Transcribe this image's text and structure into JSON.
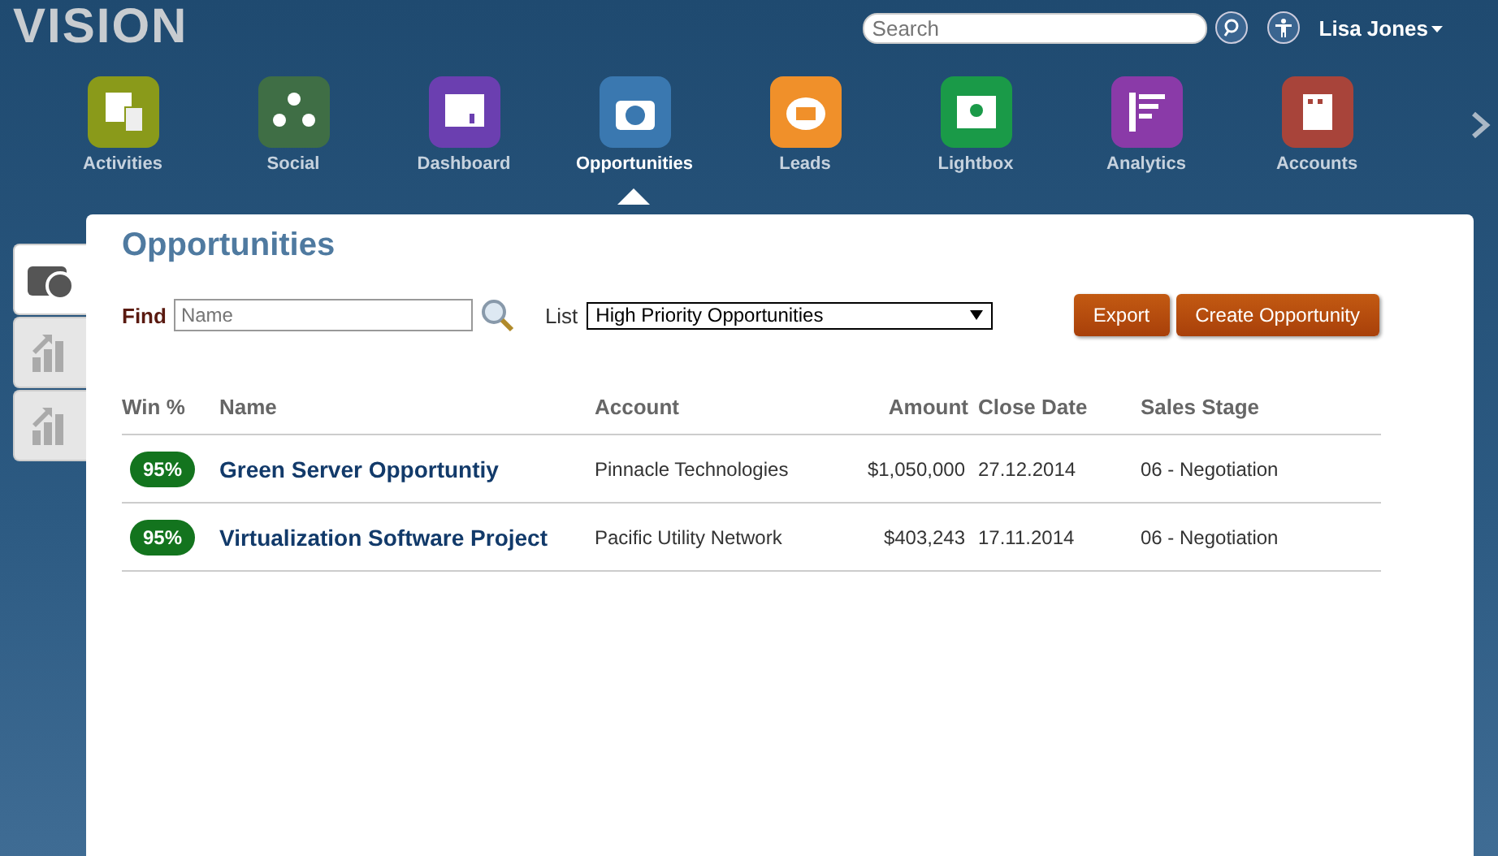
{
  "logo": "VISION",
  "search": {
    "placeholder": "Search"
  },
  "user": {
    "name": "Lisa Jones"
  },
  "nav": [
    {
      "label": "Activities",
      "kind": "grid",
      "color": "#8a9a1a",
      "selected": false
    },
    {
      "label": "Social",
      "kind": "people",
      "color": "#3f6e45",
      "selected": false
    },
    {
      "label": "Dashboard",
      "kind": "board",
      "color": "#6b3fb0",
      "selected": false
    },
    {
      "label": "Opportunities",
      "kind": "camera",
      "color": "#3a78b0",
      "selected": true
    },
    {
      "label": "Leads",
      "kind": "lead",
      "color": "#f0902a",
      "selected": false
    },
    {
      "label": "Lightbox",
      "kind": "bulb",
      "color": "#1a9a48",
      "selected": false
    },
    {
      "label": "Analytics",
      "kind": "bars",
      "color": "#8a3aa8",
      "selected": false
    },
    {
      "label": "Accounts",
      "kind": "building",
      "color": "#a8443a",
      "selected": false
    }
  ],
  "side_tabs": [
    {
      "kind": "camera",
      "selected": true
    },
    {
      "kind": "chart",
      "selected": false
    },
    {
      "kind": "chart",
      "selected": false
    }
  ],
  "page": {
    "title": "Opportunities",
    "find_label": "Find",
    "find": {
      "placeholder": "Name"
    },
    "list_label": "List",
    "list_value": "High Priority Opportunities",
    "buttons": [
      "Export",
      "Create Opportunity"
    ]
  },
  "table": {
    "columns": [
      "Win %",
      "Name",
      "Account",
      "Amount",
      "Close Date",
      "Sales Stage"
    ],
    "rows": [
      {
        "win": "95%",
        "name": "Green Server Opportuntiy",
        "account": "Pinnacle Technologies",
        "amount": "$1,050,000",
        "close_date": "27.12.2014",
        "stage": "06 - Negotiation"
      },
      {
        "win": "95%",
        "name": "Virtualization Software Project",
        "account": "Pacific Utility Network",
        "amount": "$403,243",
        "close_date": "17.11.2014",
        "stage": "06 - Negotiation"
      }
    ]
  }
}
